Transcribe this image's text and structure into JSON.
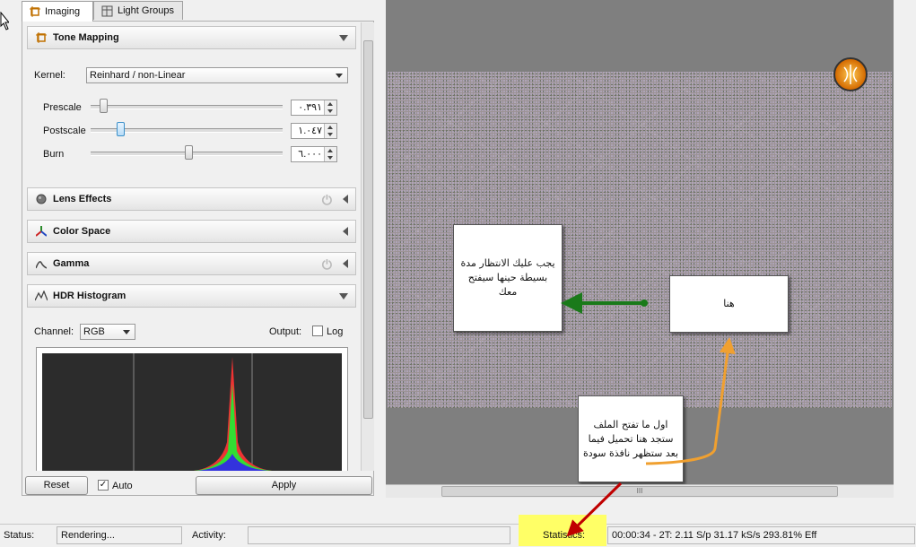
{
  "tabs": [
    {
      "label": "Imaging",
      "icon": "imaging-icon"
    },
    {
      "label": "Light Groups",
      "icon": "light-groups-icon"
    }
  ],
  "tone_mapping": {
    "title": "Tone Mapping",
    "kernel_label": "Kernel:",
    "kernel_value": "Reinhard / non-Linear",
    "prescale_label": "Prescale",
    "prescale_value": "٠.٣٩١",
    "prescale_fraction": 0.05,
    "postscale_label": "Postscale",
    "postscale_value": "١.٠٤٧",
    "postscale_fraction": 0.14,
    "burn_label": "Burn",
    "burn_value": "٦.٠٠٠",
    "burn_fraction": 0.51
  },
  "sections": {
    "lens_effects": "Lens Effects",
    "color_space": "Color Space",
    "gamma": "Gamma",
    "hdr_histogram": "HDR Histogram"
  },
  "histogram": {
    "channel_label": "Channel:",
    "channel_value": "RGB",
    "output_label": "Output:",
    "log_label": "Log",
    "log_checked": false
  },
  "footer": {
    "reset_label": "Reset",
    "auto_label": "Auto",
    "auto_checked": true,
    "apply_label": "Apply"
  },
  "notes": {
    "wait": "يجب عليك الانتظار مدة بسيطة حينها سيفتح معك",
    "here": "هنا",
    "loading": "اول ما تفتح الملف ستجد هنا تحميل فيما بعد ستظهر نافذة سودة"
  },
  "statusbar": {
    "status_label": "Status:",
    "status_value": "Rendering...",
    "activity_label": "Activity:",
    "activity_value": "",
    "statistics_label": "Statistics:",
    "statistics_value": "00:00:34 - 2T: 2.11 S/p 31.17 kS/s 293.81% Eff"
  },
  "hscroll_grip": "III",
  "colors": {
    "highlight": "#ffff66",
    "arrow_green": "#1a7a1a",
    "arrow_orange": "#f0a030",
    "arrow_red": "#c00000"
  }
}
